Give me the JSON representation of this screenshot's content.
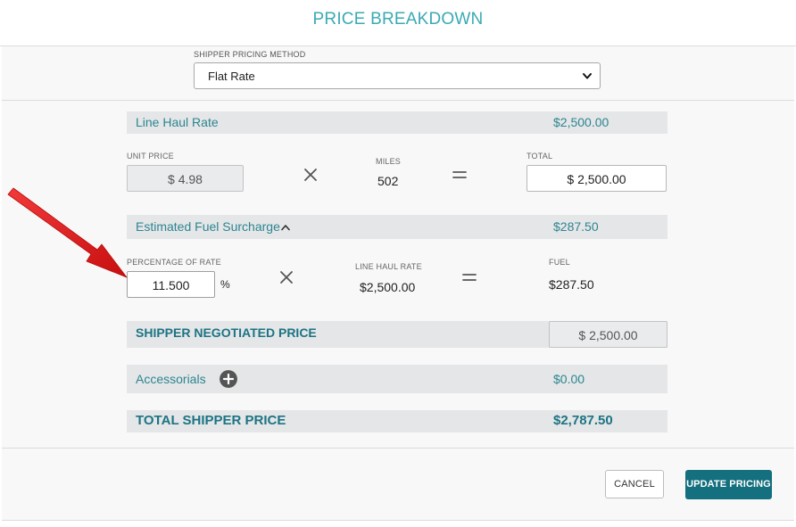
{
  "modal": {
    "title": "PRICE BREAKDOWN"
  },
  "pricing_method": {
    "label": "SHIPPER PRICING METHOD",
    "selected": "Flat Rate"
  },
  "line_haul": {
    "label": "Line Haul Rate",
    "amount": "$2,500.00",
    "unit_price_label": "UNIT PRICE",
    "unit_price": "$ 4.98",
    "miles_label": "MILES",
    "miles": "502",
    "total_label": "TOTAL",
    "total": "$ 2,500.00"
  },
  "fuel": {
    "label": "Estimated Fuel Surcharge",
    "amount": "$287.50",
    "percentage_label": "PERCENTAGE OF RATE",
    "percentage": "11.500",
    "percent_sign": "%",
    "line_haul_label": "LINE HAUL RATE",
    "line_haul_value": "$2,500.00",
    "fuel_label": "FUEL",
    "fuel_value": "$287.50"
  },
  "negotiated": {
    "label": "SHIPPER NEGOTIATED PRICE",
    "value": "$ 2,500.00"
  },
  "accessorials": {
    "label": "Accessorials",
    "amount": "$0.00"
  },
  "total": {
    "label": "TOTAL SHIPPER PRICE",
    "amount": "$2,787.50"
  },
  "footer": {
    "cancel_label": "CANCEL",
    "update_label": "UPDATE PRICING"
  },
  "colors": {
    "accent": "#3aaab4",
    "teal_text": "#2d8591",
    "button": "#146f7e",
    "band": "#e4e6e7",
    "annotation_arrow": "#e31b1b"
  },
  "icons": [
    "chevron-down-icon",
    "multiply-icon",
    "equals-icon",
    "chevron-up-icon",
    "plus-circle-icon",
    "annotation-arrow"
  ]
}
